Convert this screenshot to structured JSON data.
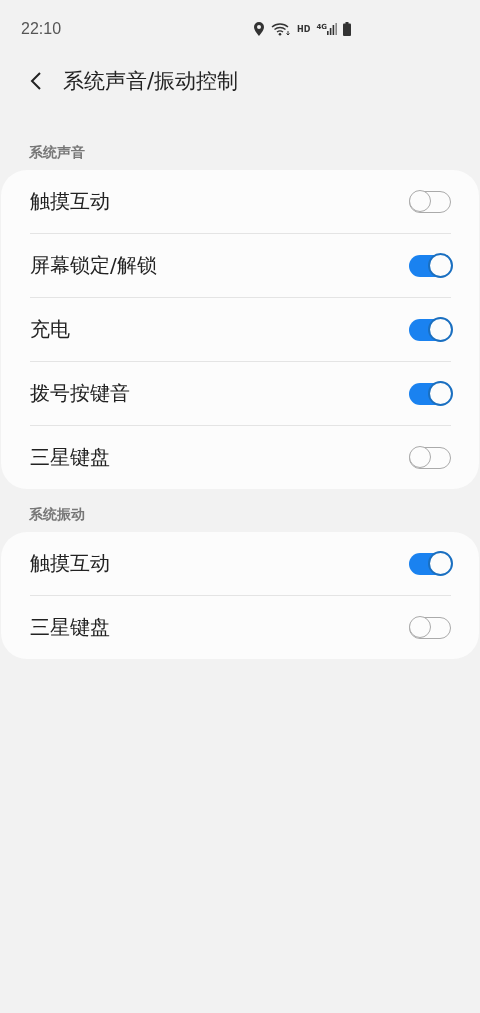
{
  "status_bar": {
    "time": "22:10",
    "hd": "HD",
    "network": "4G"
  },
  "header": {
    "title": "系统声音/振动控制"
  },
  "sections": [
    {
      "title": "系统声音",
      "items": [
        {
          "label": "触摸互动",
          "on": false
        },
        {
          "label": "屏幕锁定/解锁",
          "on": true
        },
        {
          "label": "充电",
          "on": true
        },
        {
          "label": "拨号按键音",
          "on": true
        },
        {
          "label": "三星键盘",
          "on": false
        }
      ]
    },
    {
      "title": "系统振动",
      "items": [
        {
          "label": "触摸互动",
          "on": true
        },
        {
          "label": "三星键盘",
          "on": false
        }
      ]
    }
  ]
}
